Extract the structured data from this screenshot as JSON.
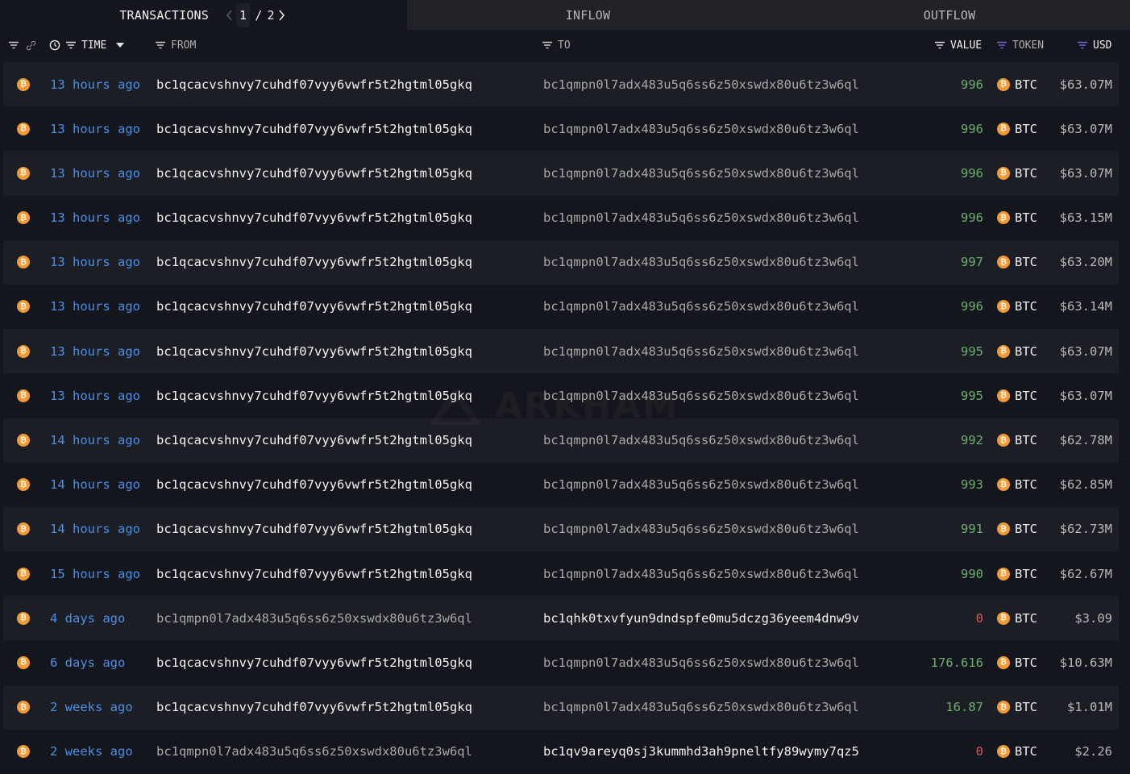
{
  "tabs": {
    "transactions": "TRANSACTIONS",
    "inflow": "INFLOW",
    "outflow": "OUTFLOW"
  },
  "pager": {
    "current": "1",
    "separator": "/",
    "total": "2"
  },
  "columns": {
    "time": "TIME",
    "from": "FROM",
    "to": "TO",
    "value": "VALUE",
    "token": "TOKEN",
    "usd": "USD"
  },
  "watermark": "ARKHAM",
  "colors": {
    "time_link": "#4b8fe6",
    "value_positive": "#6cae6f",
    "value_zero": "#d85a5a",
    "btc_icon": "#f29a35",
    "filter_active": "#7b5fd6"
  },
  "rows": [
    {
      "time": "13 hours ago",
      "from": "bc1qcacvshnvy7cuhdf07vyy6vwfr5t2hgtml05gkq",
      "to": "bc1qmpn0l7adx483u5q6ss6z50xswdx80u6tz3w6ql",
      "value": "996",
      "token": "BTC",
      "usd": "$63.07M",
      "from_style": "bright",
      "to_style": "dim",
      "value_style": "pos"
    },
    {
      "time": "13 hours ago",
      "from": "bc1qcacvshnvy7cuhdf07vyy6vwfr5t2hgtml05gkq",
      "to": "bc1qmpn0l7adx483u5q6ss6z50xswdx80u6tz3w6ql",
      "value": "996",
      "token": "BTC",
      "usd": "$63.07M",
      "from_style": "bright",
      "to_style": "dim",
      "value_style": "pos"
    },
    {
      "time": "13 hours ago",
      "from": "bc1qcacvshnvy7cuhdf07vyy6vwfr5t2hgtml05gkq",
      "to": "bc1qmpn0l7adx483u5q6ss6z50xswdx80u6tz3w6ql",
      "value": "996",
      "token": "BTC",
      "usd": "$63.07M",
      "from_style": "bright",
      "to_style": "dim",
      "value_style": "pos"
    },
    {
      "time": "13 hours ago",
      "from": "bc1qcacvshnvy7cuhdf07vyy6vwfr5t2hgtml05gkq",
      "to": "bc1qmpn0l7adx483u5q6ss6z50xswdx80u6tz3w6ql",
      "value": "996",
      "token": "BTC",
      "usd": "$63.15M",
      "from_style": "bright",
      "to_style": "dim",
      "value_style": "pos"
    },
    {
      "time": "13 hours ago",
      "from": "bc1qcacvshnvy7cuhdf07vyy6vwfr5t2hgtml05gkq",
      "to": "bc1qmpn0l7adx483u5q6ss6z50xswdx80u6tz3w6ql",
      "value": "997",
      "token": "BTC",
      "usd": "$63.20M",
      "from_style": "bright",
      "to_style": "dim",
      "value_style": "pos"
    },
    {
      "time": "13 hours ago",
      "from": "bc1qcacvshnvy7cuhdf07vyy6vwfr5t2hgtml05gkq",
      "to": "bc1qmpn0l7adx483u5q6ss6z50xswdx80u6tz3w6ql",
      "value": "996",
      "token": "BTC",
      "usd": "$63.14M",
      "from_style": "bright",
      "to_style": "dim",
      "value_style": "pos"
    },
    {
      "time": "13 hours ago",
      "from": "bc1qcacvshnvy7cuhdf07vyy6vwfr5t2hgtml05gkq",
      "to": "bc1qmpn0l7adx483u5q6ss6z50xswdx80u6tz3w6ql",
      "value": "995",
      "token": "BTC",
      "usd": "$63.07M",
      "from_style": "bright",
      "to_style": "dim",
      "value_style": "pos"
    },
    {
      "time": "13 hours ago",
      "from": "bc1qcacvshnvy7cuhdf07vyy6vwfr5t2hgtml05gkq",
      "to": "bc1qmpn0l7adx483u5q6ss6z50xswdx80u6tz3w6ql",
      "value": "995",
      "token": "BTC",
      "usd": "$63.07M",
      "from_style": "bright",
      "to_style": "dim",
      "value_style": "pos"
    },
    {
      "time": "14 hours ago",
      "from": "bc1qcacvshnvy7cuhdf07vyy6vwfr5t2hgtml05gkq",
      "to": "bc1qmpn0l7adx483u5q6ss6z50xswdx80u6tz3w6ql",
      "value": "992",
      "token": "BTC",
      "usd": "$62.78M",
      "from_style": "bright",
      "to_style": "dim",
      "value_style": "pos"
    },
    {
      "time": "14 hours ago",
      "from": "bc1qcacvshnvy7cuhdf07vyy6vwfr5t2hgtml05gkq",
      "to": "bc1qmpn0l7adx483u5q6ss6z50xswdx80u6tz3w6ql",
      "value": "993",
      "token": "BTC",
      "usd": "$62.85M",
      "from_style": "bright",
      "to_style": "dim",
      "value_style": "pos"
    },
    {
      "time": "14 hours ago",
      "from": "bc1qcacvshnvy7cuhdf07vyy6vwfr5t2hgtml05gkq",
      "to": "bc1qmpn0l7adx483u5q6ss6z50xswdx80u6tz3w6ql",
      "value": "991",
      "token": "BTC",
      "usd": "$62.73M",
      "from_style": "bright",
      "to_style": "dim",
      "value_style": "pos"
    },
    {
      "time": "15 hours ago",
      "from": "bc1qcacvshnvy7cuhdf07vyy6vwfr5t2hgtml05gkq",
      "to": "bc1qmpn0l7adx483u5q6ss6z50xswdx80u6tz3w6ql",
      "value": "990",
      "token": "BTC",
      "usd": "$62.67M",
      "from_style": "bright",
      "to_style": "dim",
      "value_style": "pos"
    },
    {
      "time": "4 days ago",
      "from": "bc1qmpn0l7adx483u5q6ss6z50xswdx80u6tz3w6ql",
      "to": "bc1qhk0txvfyun9dndspfe0mu5dczg36yeem4dnw9v",
      "value": "0",
      "token": "BTC",
      "usd": "$3.09",
      "from_style": "dim",
      "to_style": "bright",
      "value_style": "zero"
    },
    {
      "time": "6 days ago",
      "from": "bc1qcacvshnvy7cuhdf07vyy6vwfr5t2hgtml05gkq",
      "to": "bc1qmpn0l7adx483u5q6ss6z50xswdx80u6tz3w6ql",
      "value": "176.616",
      "token": "BTC",
      "usd": "$10.63M",
      "from_style": "bright",
      "to_style": "dim",
      "value_style": "pos"
    },
    {
      "time": "2 weeks ago",
      "from": "bc1qcacvshnvy7cuhdf07vyy6vwfr5t2hgtml05gkq",
      "to": "bc1qmpn0l7adx483u5q6ss6z50xswdx80u6tz3w6ql",
      "value": "16.87",
      "token": "BTC",
      "usd": "$1.01M",
      "from_style": "bright",
      "to_style": "dim",
      "value_style": "pos"
    },
    {
      "time": "2 weeks ago",
      "from": "bc1qmpn0l7adx483u5q6ss6z50xswdx80u6tz3w6ql",
      "to": "bc1qv9areyq0sj3kummhd3ah9pneltfy89wymy7qz5",
      "value": "0",
      "token": "BTC",
      "usd": "$2.26",
      "from_style": "dim",
      "to_style": "bright",
      "value_style": "zero"
    }
  ]
}
